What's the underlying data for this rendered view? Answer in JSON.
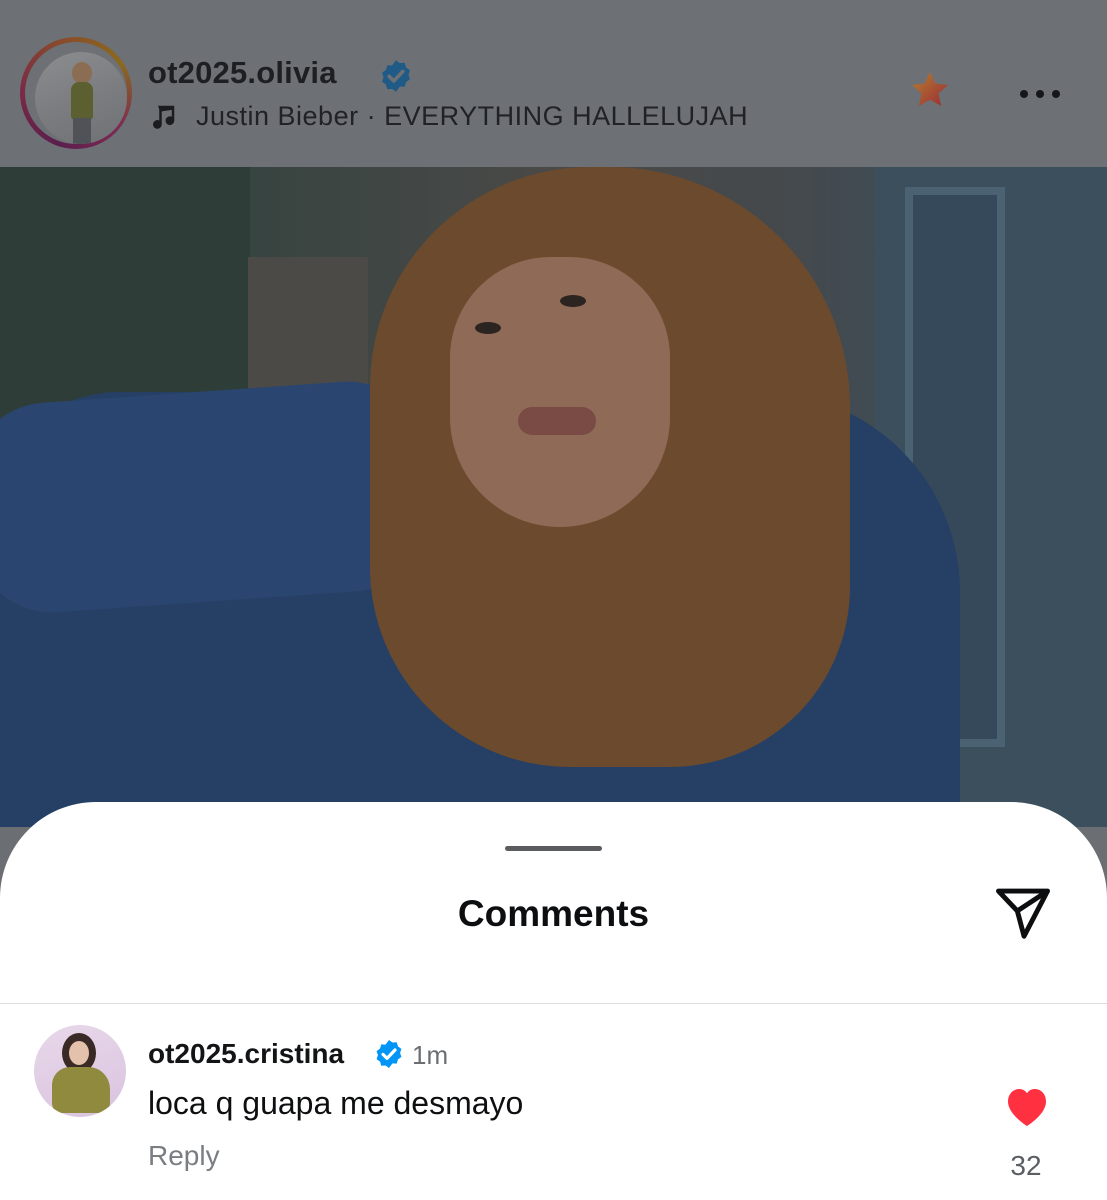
{
  "post": {
    "username": "ot2025.olivia",
    "music": {
      "artist": "Justin Bieber",
      "separator": "·",
      "song": "EVERYTHING HALLELUJAH",
      "line": "Justin Bieber · EVERYTHING HALLELUJAH"
    },
    "icons": [
      "music-note-icon",
      "verified-badge-icon",
      "star-icon",
      "more-options-icon"
    ]
  },
  "sheet": {
    "title": "Comments",
    "share_icon": "send-paper-plane-icon"
  },
  "comments": [
    {
      "username": "ot2025.cristina",
      "time": "1m",
      "text": "loca q guapa me desmayo",
      "reply_label": "Reply",
      "likes": "32",
      "liked": true
    }
  ],
  "colors": {
    "verified_blue": "#0095f6",
    "like_red": "#ff3040",
    "star_gradient_start": "#e2a33a",
    "star_gradient_end": "#c0283a"
  }
}
